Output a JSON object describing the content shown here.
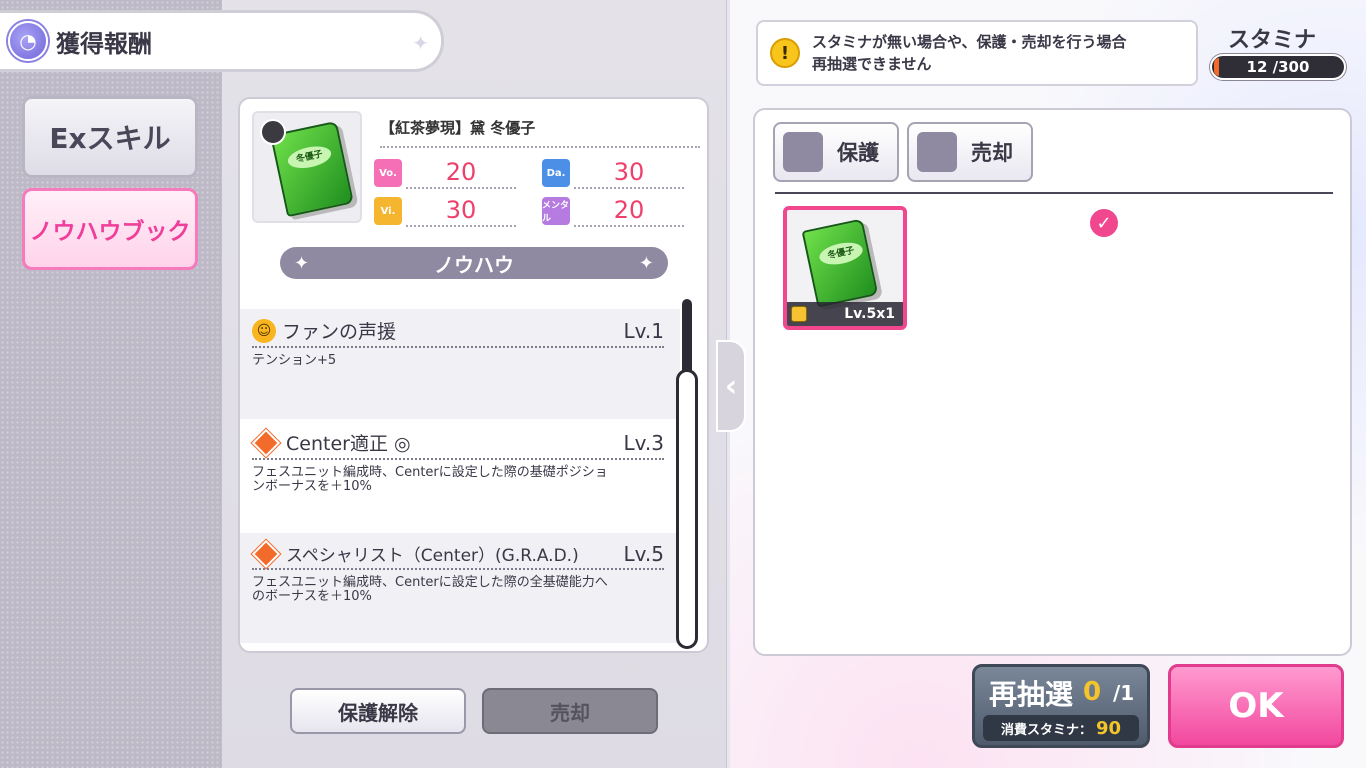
{
  "header": {
    "title": "獲得報酬"
  },
  "tabs": [
    {
      "label": "Exスキル"
    },
    {
      "label": "ノウハウブック"
    }
  ],
  "item": {
    "name": "【紅茶夢現】黛 冬優子",
    "book_label": "冬優子",
    "stats": {
      "vo": {
        "icon": "Vo.",
        "value": "20"
      },
      "da": {
        "icon": "Da.",
        "value": "30"
      },
      "vi": {
        "icon": "Vi.",
        "value": "30"
      },
      "me": {
        "icon": "メンタル",
        "value": "20"
      }
    }
  },
  "knowhow_banner": "ノウハウ",
  "skills": [
    {
      "name": "ファンの声援",
      "level": "Lv.1",
      "desc": "テンション+5",
      "icon": "smile-icon"
    },
    {
      "name": "Center適正 ◎",
      "level": "Lv.3",
      "desc": "フェスユニット編成時、Centerに設定した際の基礎ポジションボーナスを＋10%",
      "icon": "diamond-icon"
    },
    {
      "name": "スペシャリスト（Center）(G.R.A.D.)",
      "level": "Lv.5",
      "desc": "フェスユニット編成時、Centerに設定した際の全基礎能力へのボーナスを＋10%",
      "icon": "diamond-icon"
    }
  ],
  "buttons": {
    "unprotect": "保護解除",
    "sell_left": "売却",
    "filter_protect": "保護",
    "filter_sell": "売却",
    "reroll_title": "再抽選",
    "reroll_count": "0",
    "reroll_total": "/1",
    "reroll_cost_label": "消費スタミナ：",
    "reroll_cost_value": "90",
    "ok": "OK"
  },
  "notice": {
    "line1": "スタミナが無い場合や、保護・売却を行う場合",
    "line2": "再抽選できません"
  },
  "stamina": {
    "label": "スタミナ",
    "text": "12 /300",
    "current": 12,
    "max": 300
  },
  "inventory": [
    {
      "book_label": "冬優子",
      "level_text": "Lv.5x1",
      "selected": true,
      "locked": true
    }
  ],
  "colors": {
    "accent_pink": "#f0478f",
    "stamina_orange": "#f36b2b",
    "stat_red": "#ef3f6b"
  }
}
